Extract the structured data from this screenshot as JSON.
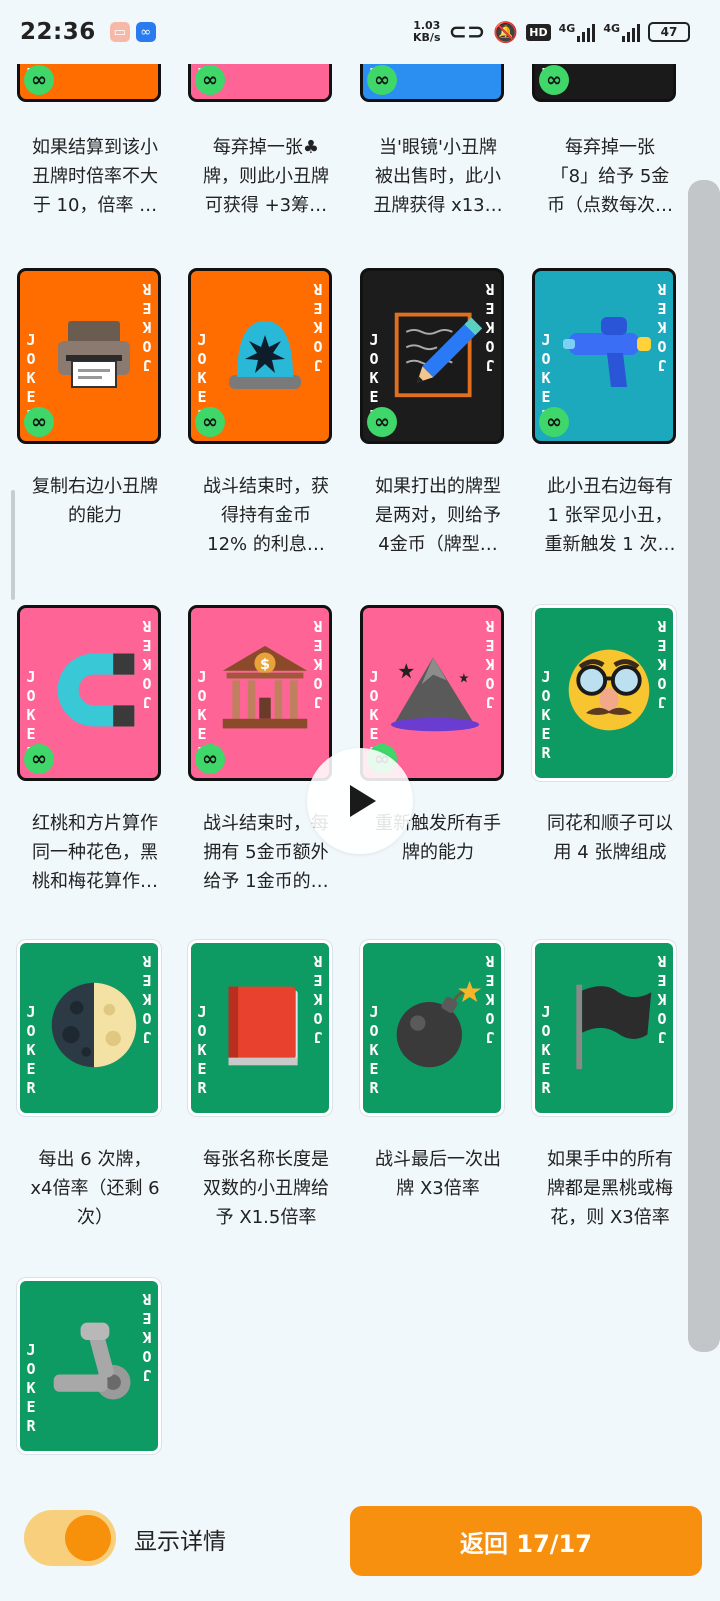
{
  "status": {
    "time": "22:36",
    "net_speed_value": "1.03",
    "net_speed_unit": "KB/s",
    "hd": "HD",
    "signal1": "4G",
    "signal2": "4G",
    "battery": "47"
  },
  "card_label": "JOKER",
  "infinity": "∞",
  "partial_row": [
    {
      "bg": "#ff6c00",
      "lines": [
        "如果结算到该小",
        "丑牌时倍率不大",
        "于 10，倍率 …"
      ]
    },
    {
      "bg": "#ff6497",
      "lines": [
        "每弃掉一张♣",
        "牌，则此小丑牌",
        "可获得 +3筹…"
      ]
    },
    {
      "bg": "#2a8ff0",
      "lines": [
        "当'眼镜'小丑牌",
        "被出售时，此小",
        "丑牌获得 x13…"
      ]
    },
    {
      "bg": "#1a1a1a",
      "lines": [
        "每弃掉一张",
        "「8」给予 5金",
        "币（点数每次…"
      ]
    }
  ],
  "rows": [
    [
      {
        "bg": "#ff6c00",
        "art": "printer-icon",
        "infinite": true,
        "lines": [
          "复制右边小丑牌",
          "的能力"
        ]
      },
      {
        "bg": "#ff6c00",
        "art": "siren-icon",
        "infinite": true,
        "lines": [
          "战斗结束时，获",
          "得持有金币",
          "12% 的利息…"
        ]
      },
      {
        "bg": "#1c1c1c",
        "art": "pencil-icon",
        "infinite": true,
        "lines": [
          "如果打出的牌型",
          "是两对，则给予",
          "4金币（牌型…"
        ]
      },
      {
        "bg": "#1ca9bd",
        "art": "water-gun-icon",
        "infinite": true,
        "lines": [
          "此小丑右边每有",
          "1 张罕见小丑，",
          "重新触发 1 次…"
        ]
      }
    ],
    [
      {
        "bg": "#ff6497",
        "art": "magnet-icon",
        "infinite": true,
        "lines": [
          "红桃和方片算作",
          "同一种花色，黑",
          "桃和梅花算作…"
        ]
      },
      {
        "bg": "#ff6497",
        "art": "bank-icon",
        "infinite": true,
        "lines": [
          "战斗结束时，每",
          "拥有 5金币额外",
          "给予 1金币的…"
        ]
      },
      {
        "bg": "#ff6497",
        "art": "mountain-icon",
        "infinite": true,
        "lines": [
          "重新触发所有手",
          "牌的能力"
        ]
      },
      {
        "bg": "#0e9a63",
        "art": "disguise-face-icon",
        "infinite": false,
        "lines": [
          "同花和顺子可以",
          "用 4 张牌组成"
        ]
      }
    ],
    [
      {
        "bg": "#0e9a63",
        "art": "half-moon-icon",
        "infinite": false,
        "lines": [
          "每出 6 次牌，",
          "x4倍率（还剩 6",
          "次）"
        ]
      },
      {
        "bg": "#0e9a63",
        "art": "book-icon",
        "infinite": false,
        "lines": [
          "每张名称长度是",
          "双数的小丑牌给",
          "予 X1.5倍率"
        ]
      },
      {
        "bg": "#0e9a63",
        "art": "bomb-icon",
        "infinite": false,
        "lines": [
          "战斗最后一次出",
          "牌 X3倍率"
        ]
      },
      {
        "bg": "#0e9a63",
        "art": "black-flag-icon",
        "infinite": false,
        "lines": [
          "如果手中的所有",
          "牌都是黑桃或梅",
          "花，则 X3倍率"
        ]
      }
    ],
    [
      {
        "bg": "#0e9a63",
        "art": "mechanical-arm-icon",
        "infinite": false,
        "lines": []
      }
    ]
  ],
  "bottom": {
    "toggle_label": "显示详情",
    "return_label": "返回 17/17"
  },
  "colors": {
    "accent": "#f7900f",
    "background": "#f1f8fc",
    "infinity_badge": "#3fd66a"
  }
}
